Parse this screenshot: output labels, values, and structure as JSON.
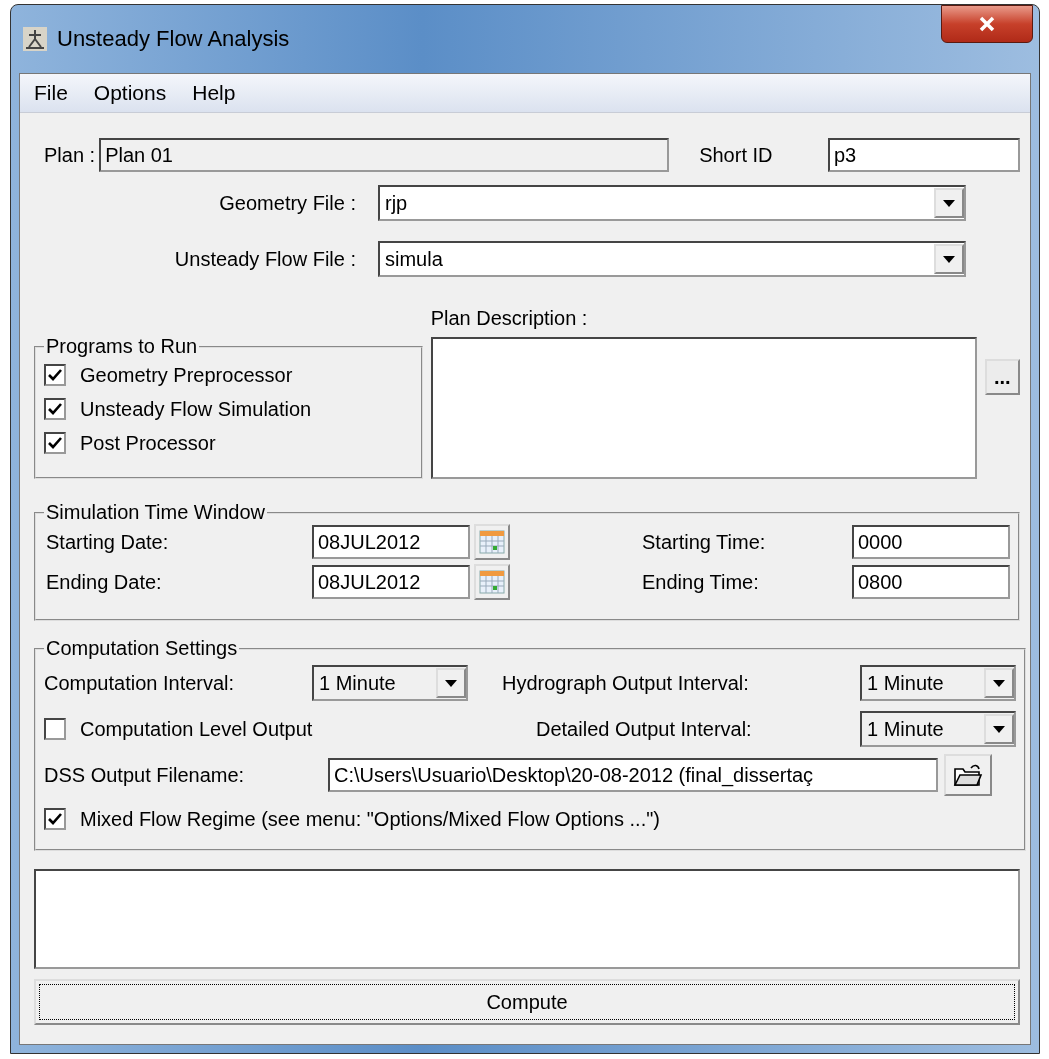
{
  "window": {
    "title": "Unsteady Flow Analysis"
  },
  "menu": [
    "File",
    "Options",
    "Help"
  ],
  "plan": {
    "label": "Plan :",
    "value": "Plan 01",
    "short_id_label": "Short ID",
    "short_id": "p3"
  },
  "files": [
    {
      "label": "Geometry File :",
      "value": "rjp"
    },
    {
      "label": "Unsteady Flow File :",
      "value": "simula"
    }
  ],
  "programs": {
    "title": "Programs to Run",
    "items": [
      {
        "label": "Geometry Preprocessor",
        "checked": true
      },
      {
        "label": "Unsteady Flow Simulation",
        "checked": true
      },
      {
        "label": "Post Processor",
        "checked": true
      }
    ]
  },
  "description": {
    "label": "Plan Description :",
    "button": "..."
  },
  "time_window": {
    "title": "Simulation Time Window",
    "starting_date_label": "Starting Date:",
    "starting_date": "08JUL2012",
    "ending_date_label": "Ending Date:",
    "ending_date": "08JUL2012",
    "starting_time_label": "Starting Time:",
    "starting_time": "0000",
    "ending_time_label": "Ending Time:",
    "ending_time": "0800"
  },
  "computation": {
    "title": "Computation Settings",
    "interval_label": "Computation Interval:",
    "interval": "1 Minute",
    "level_output": {
      "label": "Computation Level Output",
      "checked": false
    },
    "hydrograph_label": "Hydrograph Output Interval:",
    "hydrograph": "1 Minute",
    "detailed_label": "Detailed Output Interval:",
    "detailed": "1 Minute",
    "dss_label": "DSS Output Filename:",
    "dss": "C:\\Users\\Usuario\\Desktop\\20-08-2012 (final_dissertaç",
    "mixed": {
      "label": "Mixed Flow Regime (see menu: \"Options/Mixed Flow Options ...\")",
      "checked": true
    }
  },
  "compute_button": "Compute"
}
